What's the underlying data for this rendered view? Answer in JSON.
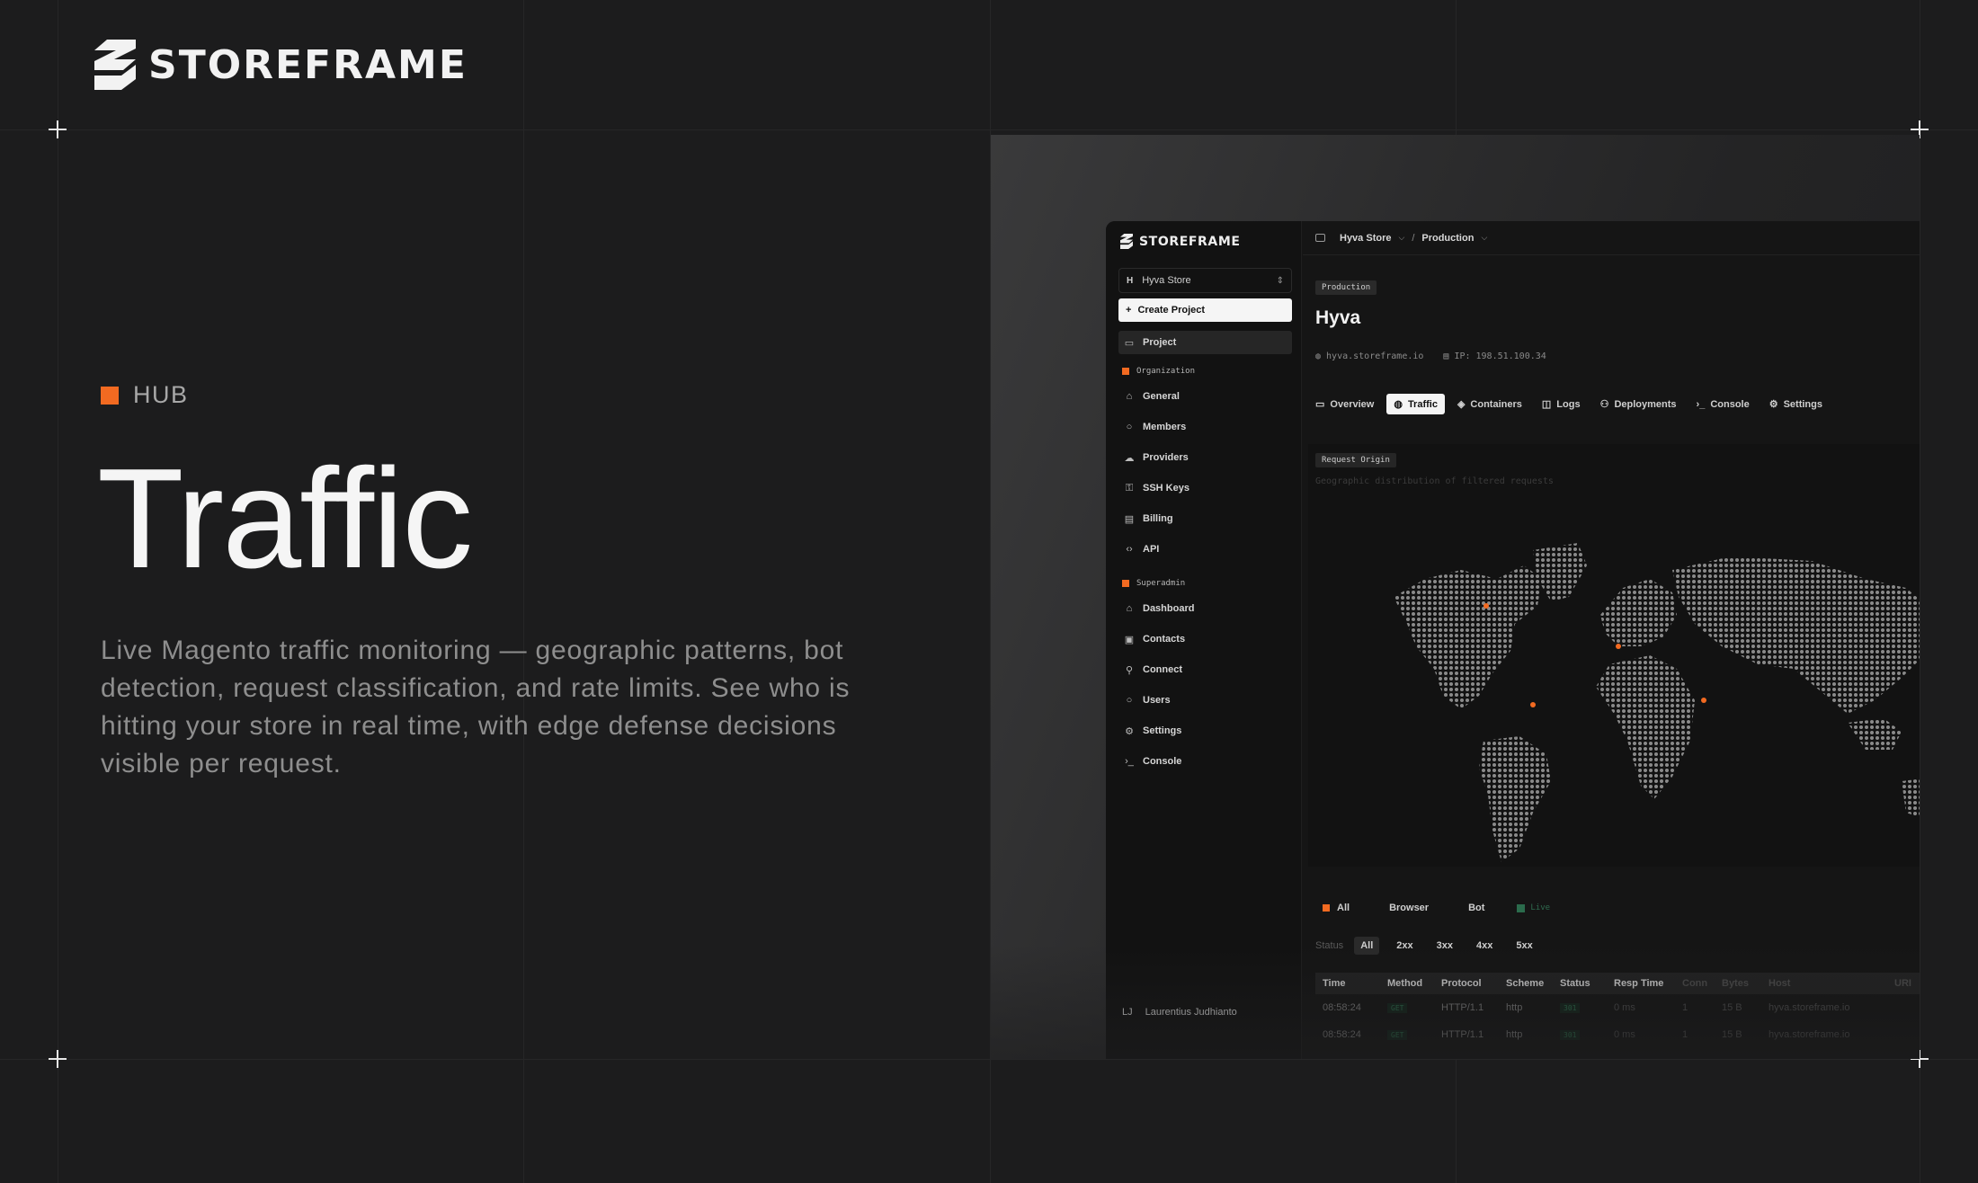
{
  "brand": {
    "name": "STOREFRAME"
  },
  "hero": {
    "eyebrow": "HUB",
    "title": "Traffic",
    "description": "Live Magento traffic monitoring — geographic patterns, bot detection, request classification, and rate limits. See who is hitting your store in real time, with edge defense decisions visible per request."
  },
  "colors": {
    "accent": "#f26a21",
    "background": "#1c1c1d",
    "live": "#2b6b4c"
  },
  "app": {
    "brand": "STOREFRAME",
    "project_selector": {
      "initial": "H",
      "label": "Hyva Store"
    },
    "create_button": "Create Project",
    "nav_primary": [
      {
        "icon": "folder-icon",
        "label": "Project"
      }
    ],
    "organization_heading": "Organization",
    "nav_org": [
      {
        "icon": "store-icon",
        "label": "General"
      },
      {
        "icon": "user-icon",
        "label": "Members"
      },
      {
        "icon": "cloud-icon",
        "label": "Providers"
      },
      {
        "icon": "key-icon",
        "label": "SSH Keys"
      },
      {
        "icon": "card-icon",
        "label": "Billing"
      },
      {
        "icon": "code-icon",
        "label": "API"
      }
    ],
    "superadmin_heading": "Superadmin",
    "nav_admin": [
      {
        "icon": "home-icon",
        "label": "Dashboard"
      },
      {
        "icon": "contacts-icon",
        "label": "Contacts"
      },
      {
        "icon": "plug-icon",
        "label": "Connect"
      },
      {
        "icon": "user-icon",
        "label": "Users"
      },
      {
        "icon": "gear-icon",
        "label": "Settings"
      },
      {
        "icon": "terminal-icon",
        "label": "Console"
      }
    ],
    "user": {
      "initials": "LJ",
      "name": "Laurentius Judhianto"
    },
    "breadcrumb": {
      "store": "Hyva Store",
      "separator": "/",
      "env": "Production"
    },
    "env_badge": "Production",
    "store_title": "Hyva",
    "domain": "hyva.storeframe.io",
    "ip": "IP: 198.51.100.34",
    "tabs": [
      {
        "icon": "monitor-icon",
        "label": "Overview",
        "active": false
      },
      {
        "icon": "globe-icon",
        "label": "Traffic",
        "active": true
      },
      {
        "icon": "containers-icon",
        "label": "Containers",
        "active": false
      },
      {
        "icon": "logs-icon",
        "label": "Logs",
        "active": false
      },
      {
        "icon": "deploy-icon",
        "label": "Deployments",
        "active": false
      },
      {
        "icon": "terminal-icon",
        "label": "Console",
        "active": false
      },
      {
        "icon": "gear-icon",
        "label": "Settings",
        "active": false
      }
    ],
    "map": {
      "label": "Request Origin",
      "subtitle": "Geographic distribution of filtered requests"
    },
    "traffic_filters": {
      "all": "All",
      "browser": "Browser",
      "bot": "Bot",
      "live": "Live"
    },
    "status_filter": {
      "label": "Status",
      "options": [
        "All",
        "2xx",
        "3xx",
        "4xx",
        "5xx"
      ]
    },
    "table": {
      "columns": [
        "Time",
        "Method",
        "Protocol",
        "Scheme",
        "Status",
        "Resp Time",
        "Conn",
        "Bytes",
        "Host",
        "URI"
      ],
      "rows": [
        [
          "08:58:24",
          "GET",
          "HTTP/1.1",
          "http",
          "301",
          "0 ms",
          "1",
          "15 B",
          "hyva.storeframe.io",
          ""
        ],
        [
          "08:58:24",
          "GET",
          "HTTP/1.1",
          "http",
          "301",
          "0 ms",
          "1",
          "15 B",
          "hyva.storeframe.io",
          ""
        ]
      ]
    }
  }
}
